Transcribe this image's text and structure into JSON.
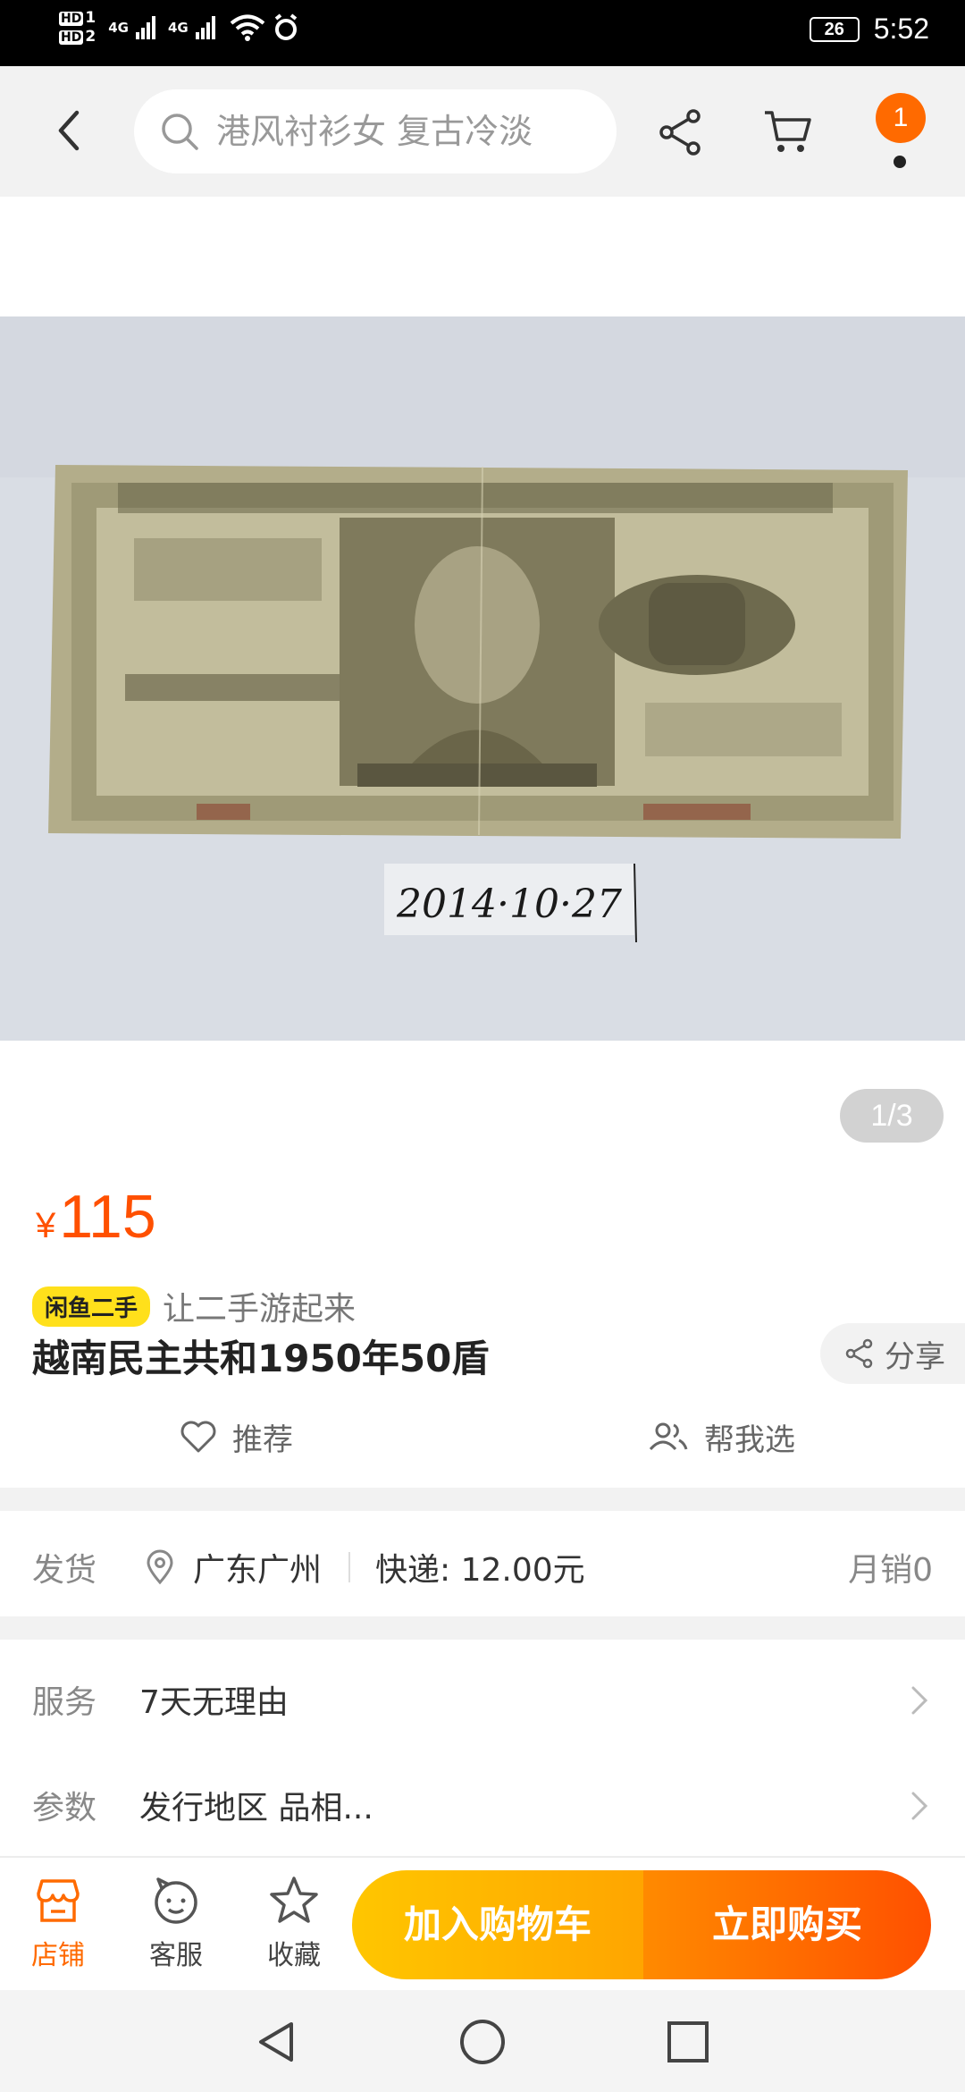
{
  "status_bar": {
    "hd1": "HD",
    "hd1_sub": "1",
    "hd2": "HD",
    "hd2_sub": "2",
    "net1": "4G",
    "net2": "4G",
    "battery": "26",
    "time": "5:52"
  },
  "header": {
    "search_placeholder": "港风衬衫女 复古冷淡",
    "notification_count": "1"
  },
  "gallery": {
    "counter": "1/3",
    "photo_handwriting": "2014·10·27"
  },
  "product": {
    "currency": "¥",
    "price": "115",
    "brand_tag": "闲鱼二手",
    "slogan": "让二手游起来",
    "title": "越南民主共和1950年50盾",
    "share_label": "分享",
    "recommend_label": "推荐",
    "help_pick_label": "帮我选"
  },
  "shipping": {
    "label": "发货",
    "location": "广东广州",
    "fee": "快递: 12.00元",
    "monthly_sales": "月销0"
  },
  "service": {
    "label": "服务",
    "value": "7天无理由"
  },
  "params": {
    "label": "参数",
    "value": "发行地区 品相..."
  },
  "bottom_bar": {
    "shop_label": "店铺",
    "cs_label": "客服",
    "fav_label": "收藏",
    "add_cart_label": "加入购物车",
    "buy_now_label": "立即购买"
  },
  "colors": {
    "accent": "#ff5000",
    "badge": "#ff6a00",
    "cart_button": "#ffb300",
    "buy_button": "#ff6200",
    "brand_tag": "#ffe01b"
  }
}
